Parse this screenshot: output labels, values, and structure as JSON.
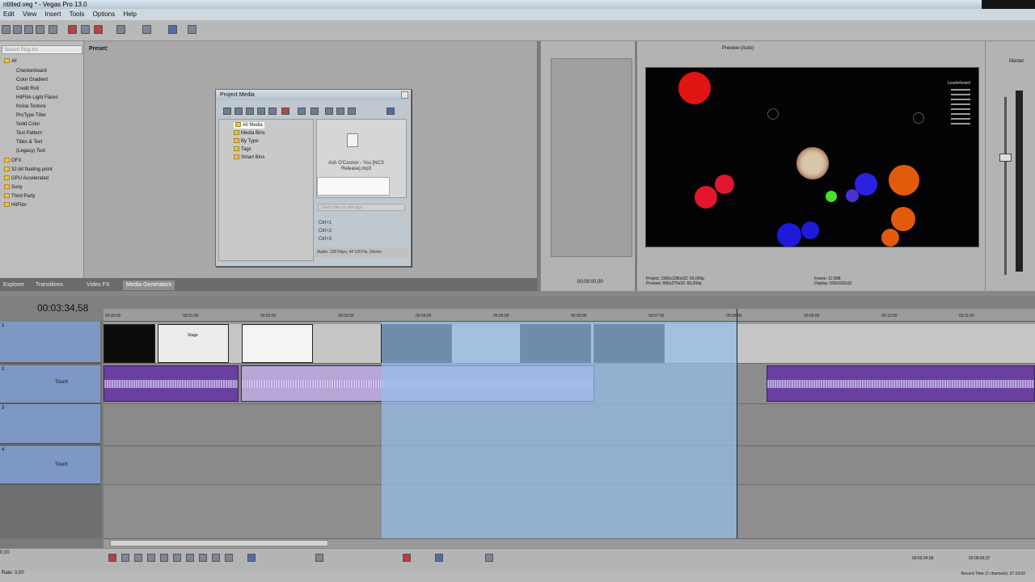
{
  "window": {
    "title": "ntitled.veg * - Vegas Pro 13.0"
  },
  "menu": [
    "Edit",
    "View",
    "Insert",
    "Tools",
    "Options",
    "Help"
  ],
  "media_generators": {
    "search_placeholder": "Search Plug-ins",
    "preset_label": "Preset:",
    "tree": [
      "All",
      "Checkerboard",
      "Color Gradient",
      "Credit Roll",
      "HitFilm Light Flares",
      "Noise Texture",
      "ProType Titler",
      "Solid Color",
      "Test Pattern",
      "Titles & Text",
      "(Legacy) Text",
      "OFX",
      "32-bit floating point",
      "GPU Accelerated",
      "Sony",
      "Third Party",
      "HitFilm"
    ]
  },
  "project_media": {
    "title": "Project Media",
    "tree": [
      "All Media",
      "Media Bins",
      "By Type",
      "Tags",
      "Smart Bins"
    ],
    "file_name": "Ash O'Connor - You [NCS Release].mp3",
    "filter_placeholder": "Select filter or add tags",
    "shortcuts": [
      "Ctrl+1",
      "Ctrl+2",
      "Ctrl+3"
    ],
    "status": "Audio: 128 Kbps, 44 100 Hz, Stereo"
  },
  "tabs": [
    "Explorer",
    "Transitions",
    "Video FX",
    "Media Generators"
  ],
  "active_tab": "Media Generators",
  "trimmer": {
    "time": "00:00:00,00"
  },
  "preview": {
    "mode": "Preview (Auto)",
    "leaderboard": "Leaderboard",
    "project_info": [
      "Project:  1992x1080x32; 60,000p",
      "Preview:  996x270x32; 60,000p"
    ],
    "frame_info": [
      "Frame:  12 898",
      "Display:  593x332x32"
    ]
  },
  "master": {
    "label": "Master"
  },
  "timeline": {
    "timecode": "00:03:34,58",
    "ruler": [
      "00:00:00",
      "00:01:00",
      "00:02:00",
      "00:03:00",
      "00:04:00",
      "00:05:00",
      "00:06:00",
      "00:07:00",
      "00:08:00",
      "00:09:00",
      "00:10:00",
      "00:11:00"
    ],
    "tracks": [
      {
        "name": "1",
        "type": "video"
      },
      {
        "name": "2",
        "type": "audio",
        "mode": "Touch"
      },
      {
        "name": "3",
        "type": "video"
      },
      {
        "name": "4",
        "type": "audio",
        "mode": "Touch"
      }
    ],
    "clip_label": "Stage"
  },
  "transport": {
    "rate": "0,00",
    "rate2": "Rate: 0,00",
    "tc_a": "00:03:34,58",
    "tc_b": "00:08:00,07",
    "record_time": "Record Time (2 channels): 37:19:00"
  },
  "colors": {
    "selection": "#96bee8",
    "audio_clip": "#6a3fa0",
    "track_header": "#7d98c4"
  }
}
